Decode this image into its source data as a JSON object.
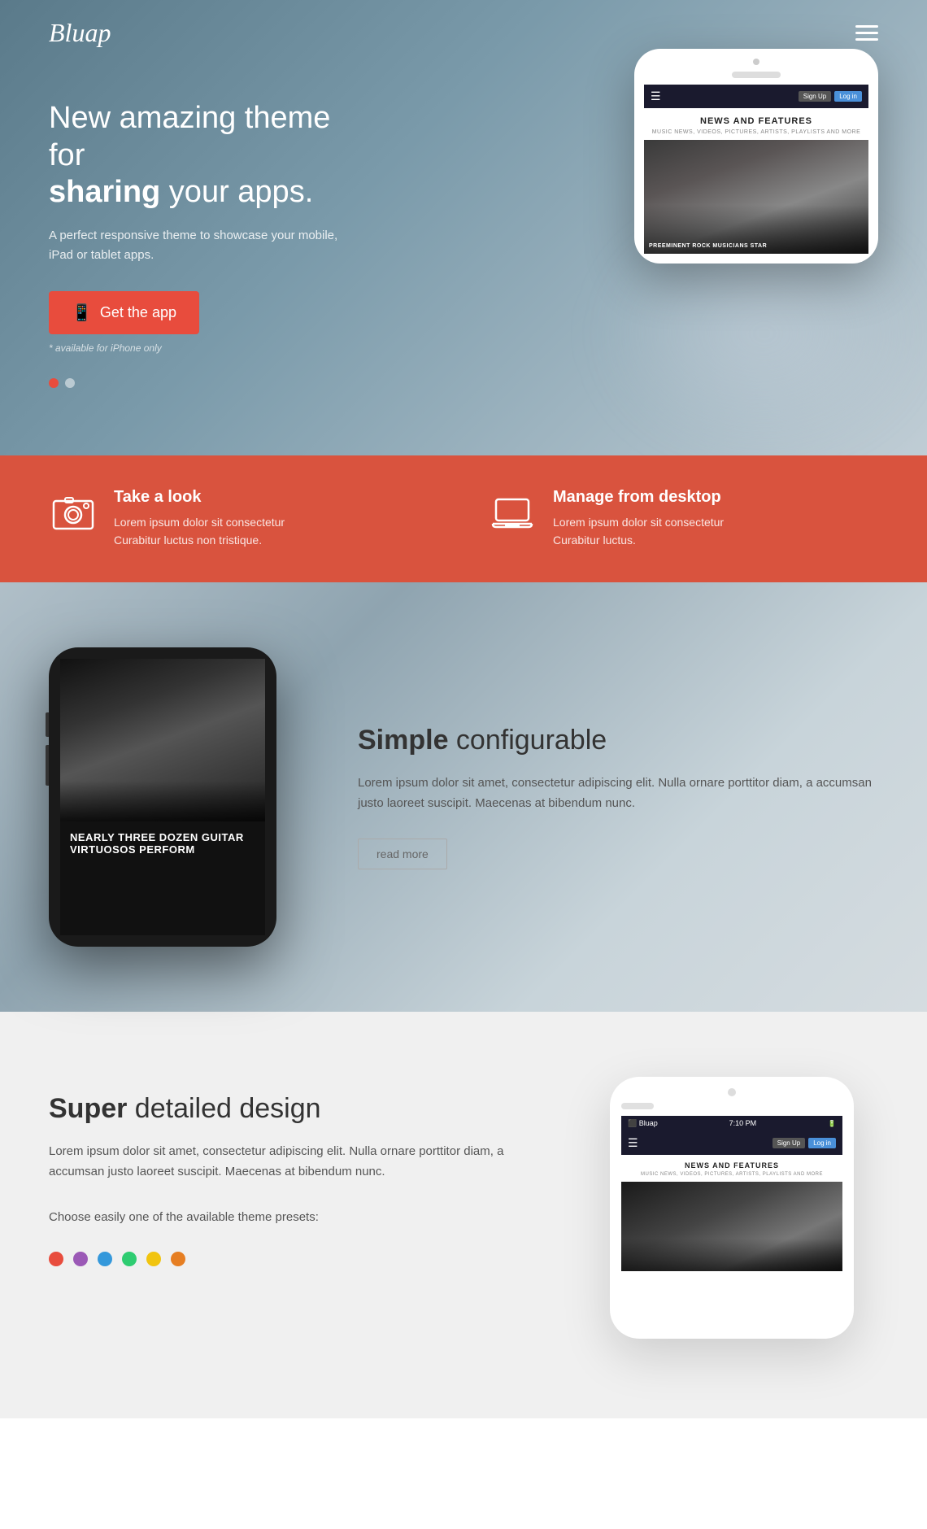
{
  "navbar": {
    "logo": "Bluap"
  },
  "hero": {
    "title_normal": "New amazing theme for",
    "title_bold": "sharing",
    "title_end": " your apps.",
    "subtitle": "A perfect responsive theme to showcase your mobile, iPad or tablet apps.",
    "cta_label": "Get the app",
    "available_note": "* available for iPhone only",
    "phone_screen": {
      "news_title": "NEWS AND FEATURES",
      "news_sub": "MUSIC NEWS, VIDEOS, PICTURES, ARTISTS, PLAYLISTS AND MORE",
      "caption": "PREEMINENT ROCK MUSICIANS STAR"
    }
  },
  "features_bar": {
    "items": [
      {
        "title": "Take a look",
        "desc_line1": "Lorem ipsum dolor sit consectetur",
        "desc_line2": "Curabitur luctus non tristique.",
        "icon": "camera-icon"
      },
      {
        "title": "Manage from desktop",
        "desc_line1": "Lorem ipsum dolor sit consectetur",
        "desc_line2": "Curabitur luctus.",
        "icon": "laptop-icon"
      }
    ]
  },
  "section_simple": {
    "title_bold": "Simple",
    "title_normal": " configurable",
    "body": "Lorem ipsum dolor sit amet, consectetur adipiscing elit. Nulla ornare porttitor diam, a accumsan justo laoreet suscipit. Maecenas at bibendum nunc.",
    "read_more": "read more",
    "phone_caption": "NEARLY THREE DOZEN GUITAR VIRTUOSOS PERFORM"
  },
  "section_super": {
    "title_bold": "Super",
    "title_normal": " detailed design",
    "body": "Lorem ipsum dolor sit amet, consectetur adipiscing elit. Nulla ornare porttitor diam, a accumsan justo laoreet suscipit. Maecenas at bibendum nunc.",
    "presets_label": "Choose easily one of the available theme presets:",
    "colors": [
      "#e84c3d",
      "#9b59b6",
      "#3498db",
      "#2ecc71",
      "#f1c40f",
      "#e67e22"
    ],
    "phone_screen": {
      "app_name": "Bluap",
      "time": "7:10 PM",
      "news_title": "NEWS AND FEATURES",
      "news_sub": "MUSIC NEWS, VIDEOS, PICTURES, ARTISTS, PLAYLISTS AND MORE"
    }
  }
}
